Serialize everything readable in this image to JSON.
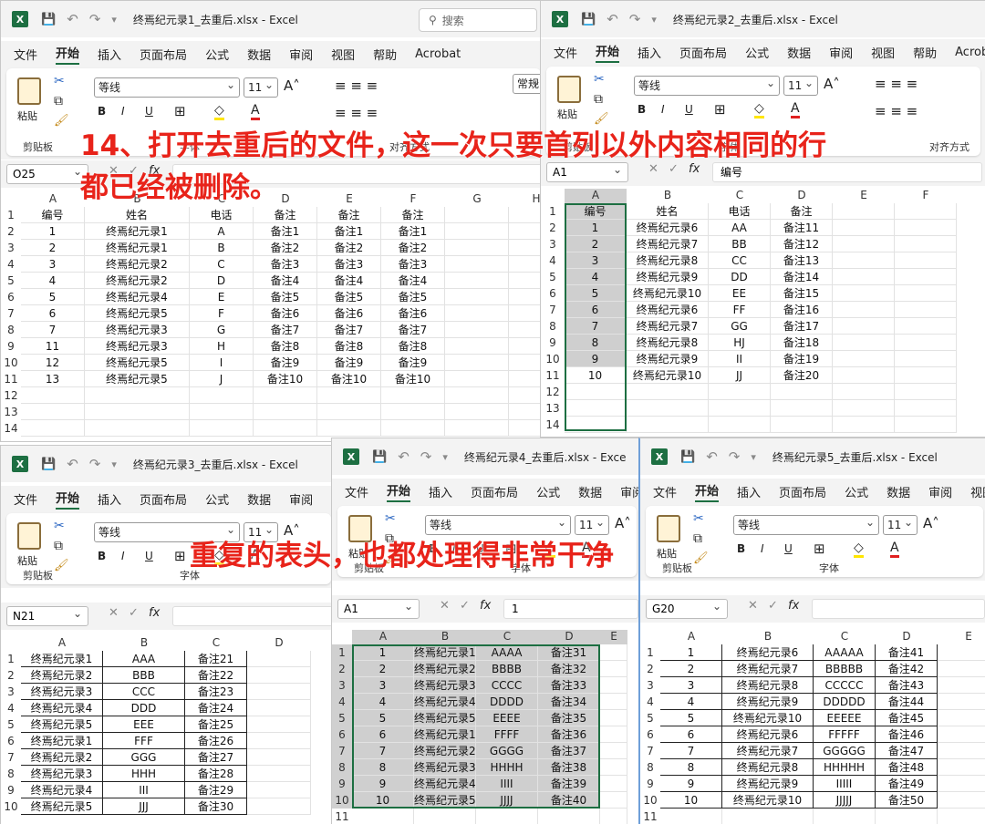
{
  "app": "Excel",
  "windows": [
    {
      "id": "w1",
      "title": "终焉纪元录1_去重后.xlsx  -  Excel",
      "search_placeholder": "搜索",
      "menu": [
        "文件",
        "开始",
        "插入",
        "页面布局",
        "公式",
        "数据",
        "审阅",
        "视图",
        "帮助",
        "Acrobat"
      ],
      "active_menu": "开始",
      "clipboard_label": "剪贴板",
      "paste_label": "粘贴",
      "font_name": "等线",
      "font_size": "11",
      "font_group_label": "字体",
      "align_group_label": "对齐方式",
      "number_format": "常规",
      "name_box": "O25",
      "formula": "",
      "columns": [
        "A",
        "B",
        "C",
        "D",
        "E",
        "F",
        "G",
        "H"
      ],
      "rows": [
        [
          "编号",
          "姓名",
          "电话",
          "备注",
          "备注",
          "备注",
          "",
          ""
        ],
        [
          "1",
          "终焉纪元录1",
          "A",
          "备注1",
          "备注1",
          "备注1",
          "",
          ""
        ],
        [
          "2",
          "终焉纪元录1",
          "B",
          "备注2",
          "备注2",
          "备注2",
          "",
          ""
        ],
        [
          "3",
          "终焉纪元录2",
          "C",
          "备注3",
          "备注3",
          "备注3",
          "",
          ""
        ],
        [
          "4",
          "终焉纪元录2",
          "D",
          "备注4",
          "备注4",
          "备注4",
          "",
          ""
        ],
        [
          "5",
          "终焉纪元录4",
          "E",
          "备注5",
          "备注5",
          "备注5",
          "",
          ""
        ],
        [
          "6",
          "终焉纪元录5",
          "F",
          "备注6",
          "备注6",
          "备注6",
          "",
          ""
        ],
        [
          "7",
          "终焉纪元录3",
          "G",
          "备注7",
          "备注7",
          "备注7",
          "",
          ""
        ],
        [
          "11",
          "终焉纪元录3",
          "H",
          "备注8",
          "备注8",
          "备注8",
          "",
          ""
        ],
        [
          "12",
          "终焉纪元录5",
          "I",
          "备注9",
          "备注9",
          "备注9",
          "",
          ""
        ],
        [
          "13",
          "终焉纪元录5",
          "J",
          "备注10",
          "备注10",
          "备注10",
          "",
          ""
        ],
        [
          "",
          "",
          "",
          "",
          "",
          "",
          "",
          ""
        ],
        [
          "",
          "",
          "",
          "",
          "",
          "",
          "",
          ""
        ],
        [
          "",
          "",
          "",
          "",
          "",
          "",
          "",
          ""
        ]
      ]
    },
    {
      "id": "w2",
      "title": "终焉纪元录2_去重后.xlsx  -  Excel",
      "menu": [
        "文件",
        "开始",
        "插入",
        "页面布局",
        "公式",
        "数据",
        "审阅",
        "视图",
        "帮助",
        "Acrobat"
      ],
      "active_menu": "开始",
      "clipboard_label": "剪贴板",
      "paste_label": "粘贴",
      "font_name": "等线",
      "font_size": "11",
      "font_group_label": "字体",
      "align_group_label": "对齐方式",
      "name_box": "A1",
      "formula": "编号",
      "columns": [
        "A",
        "B",
        "C",
        "D",
        "E",
        "F"
      ],
      "rows": [
        [
          "编号",
          "姓名",
          "电话",
          "备注",
          "",
          ""
        ],
        [
          "1",
          "终焉纪元录6",
          "AA",
          "备注11",
          "",
          ""
        ],
        [
          "2",
          "终焉纪元录7",
          "BB",
          "备注12",
          "",
          ""
        ],
        [
          "3",
          "终焉纪元录8",
          "CC",
          "备注13",
          "",
          ""
        ],
        [
          "4",
          "终焉纪元录9",
          "DD",
          "备注14",
          "",
          ""
        ],
        [
          "5",
          "终焉纪元录10",
          "EE",
          "备注15",
          "",
          ""
        ],
        [
          "6",
          "终焉纪元录6",
          "FF",
          "备注16",
          "",
          ""
        ],
        [
          "7",
          "终焉纪元录7",
          "GG",
          "备注17",
          "",
          ""
        ],
        [
          "8",
          "终焉纪元录8",
          "HJ",
          "备注18",
          "",
          ""
        ],
        [
          "9",
          "终焉纪元录9",
          "II",
          "备注19",
          "",
          ""
        ],
        [
          "10",
          "终焉纪元录10",
          "JJ",
          "备注20",
          "",
          ""
        ],
        [
          "",
          "",
          "",
          "",
          "",
          ""
        ],
        [
          "",
          "",
          "",
          "",
          "",
          ""
        ],
        [
          "",
          "",
          "",
          "",
          "",
          ""
        ]
      ]
    },
    {
      "id": "w3",
      "title": "终焉纪元录3_去重后.xlsx  -  Excel",
      "menu": [
        "文件",
        "开始",
        "插入",
        "页面布局",
        "公式",
        "数据",
        "审阅",
        "视图"
      ],
      "active_menu": "开始",
      "clipboard_label": "剪贴板",
      "paste_label": "粘贴",
      "font_name": "等线",
      "font_size": "11",
      "font_group_label": "字体",
      "name_box": "N21",
      "formula": "",
      "columns": [
        "A",
        "B",
        "C",
        "D"
      ],
      "rows": [
        [
          "终焉纪元录1",
          "AAA",
          "备注21",
          ""
        ],
        [
          "终焉纪元录2",
          "BBB",
          "备注22",
          ""
        ],
        [
          "终焉纪元录3",
          "CCC",
          "备注23",
          ""
        ],
        [
          "终焉纪元录4",
          "DDD",
          "备注24",
          ""
        ],
        [
          "终焉纪元录5",
          "EEE",
          "备注25",
          ""
        ],
        [
          "终焉纪元录1",
          "FFF",
          "备注26",
          ""
        ],
        [
          "终焉纪元录2",
          "GGG",
          "备注27",
          ""
        ],
        [
          "终焉纪元录3",
          "HHH",
          "备注28",
          ""
        ],
        [
          "终焉纪元录4",
          "III",
          "备注29",
          ""
        ],
        [
          "终焉纪元录5",
          "JJJ",
          "备注30",
          ""
        ]
      ]
    },
    {
      "id": "w4",
      "title": "终焉纪元录4_去重后.xlsx  -  Exce",
      "menu": [
        "文件",
        "开始",
        "插入",
        "页面布局",
        "公式",
        "数据",
        "审阅"
      ],
      "active_menu": "开始",
      "clipboard_label": "剪贴板",
      "paste_label": "粘贴",
      "font_name": "等线",
      "font_size": "11",
      "font_group_label": "字体",
      "name_box": "A1",
      "formula": "1",
      "columns": [
        "A",
        "B",
        "C",
        "D",
        "E"
      ],
      "rows": [
        [
          "1",
          "终焉纪元录1",
          "AAAA",
          "备注31",
          ""
        ],
        [
          "2",
          "终焉纪元录2",
          "BBBB",
          "备注32",
          ""
        ],
        [
          "3",
          "终焉纪元录3",
          "CCCC",
          "备注33",
          ""
        ],
        [
          "4",
          "终焉纪元录4",
          "DDDD",
          "备注34",
          ""
        ],
        [
          "5",
          "终焉纪元录5",
          "EEEE",
          "备注35",
          ""
        ],
        [
          "6",
          "终焉纪元录1",
          "FFFF",
          "备注36",
          ""
        ],
        [
          "7",
          "终焉纪元录2",
          "GGGG",
          "备注37",
          ""
        ],
        [
          "8",
          "终焉纪元录3",
          "HHHH",
          "备注38",
          ""
        ],
        [
          "9",
          "终焉纪元录4",
          "IIII",
          "备注39",
          ""
        ],
        [
          "10",
          "终焉纪元录5",
          "JJJJ",
          "备注40",
          ""
        ],
        [
          "",
          "",
          "",
          "",
          ""
        ]
      ]
    },
    {
      "id": "w5",
      "title": "终焉纪元录5_去重后.xlsx  -  Excel",
      "menu": [
        "文件",
        "开始",
        "插入",
        "页面布局",
        "公式",
        "数据",
        "审阅",
        "视图"
      ],
      "active_menu": "开始",
      "clipboard_label": "剪贴板",
      "paste_label": "粘贴",
      "font_name": "等线",
      "font_size": "11",
      "font_group_label": "字体",
      "name_box": "G20",
      "formula": "",
      "columns": [
        "A",
        "B",
        "C",
        "D",
        "E"
      ],
      "rows": [
        [
          "1",
          "终焉纪元录6",
          "AAAAA",
          "备注41",
          ""
        ],
        [
          "2",
          "终焉纪元录7",
          "BBBBB",
          "备注42",
          ""
        ],
        [
          "3",
          "终焉纪元录8",
          "CCCCC",
          "备注43",
          ""
        ],
        [
          "4",
          "终焉纪元录9",
          "DDDDD",
          "备注44",
          ""
        ],
        [
          "5",
          "终焉纪元录10",
          "EEEEE",
          "备注45",
          ""
        ],
        [
          "6",
          "终焉纪元录6",
          "FFFFF",
          "备注46",
          ""
        ],
        [
          "7",
          "终焉纪元录7",
          "GGGGG",
          "备注47",
          ""
        ],
        [
          "8",
          "终焉纪元录8",
          "HHHHH",
          "备注48",
          ""
        ],
        [
          "9",
          "终焉纪元录9",
          "IIIII",
          "备注49",
          ""
        ],
        [
          "10",
          "终焉纪元录10",
          "JJJJJ",
          "备注50",
          ""
        ],
        [
          "",
          "",
          "",
          "",
          ""
        ]
      ]
    }
  ],
  "annotations": {
    "top_line1": "14、打开去重后的文件，这一次只要首列以外内容相同的行",
    "top_line2": "都已经被删除。",
    "bottom": "重复的表头，也都处理得非常干净"
  },
  "colors": {
    "excel_green": "#1d6f42",
    "annotation_red": "#e8231a",
    "selection_gray": "#cfcfcf"
  }
}
